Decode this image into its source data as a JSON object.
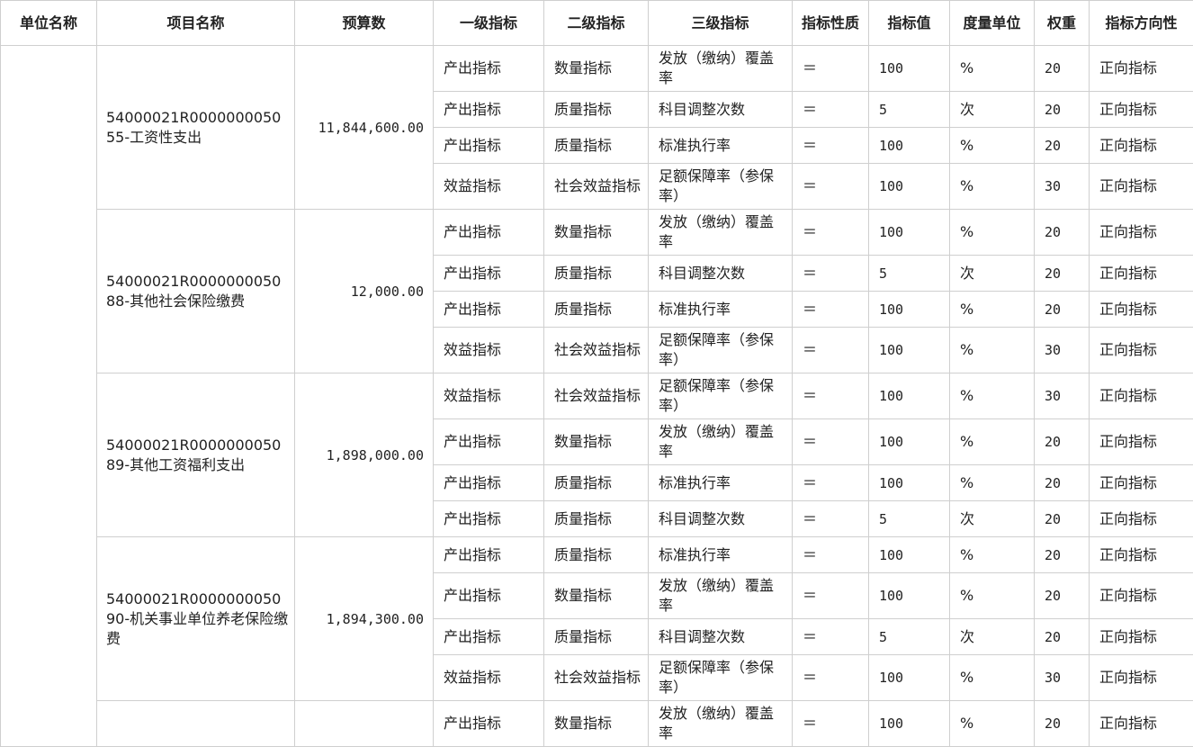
{
  "headers": [
    "单位名称",
    "项目名称",
    "预算数",
    "一级指标",
    "二级指标",
    "三级指标",
    "指标性质",
    "指标值",
    "度量单位",
    "权重",
    "指标方向性"
  ],
  "unit_name": "",
  "projects": [
    {
      "name": "54000021R000000005055-工资性支出",
      "budget": "11,844,600.00",
      "rows": [
        {
          "l1": "产出指标",
          "l2": "数量指标",
          "l3": "发放（缴纳）覆盖率",
          "nature": "＝",
          "value": "100",
          "unit": "%",
          "weight": "20",
          "direction": "正向指标"
        },
        {
          "l1": "产出指标",
          "l2": "质量指标",
          "l3": "科目调整次数",
          "nature": "＝",
          "value": "5",
          "unit": "次",
          "weight": "20",
          "direction": "正向指标"
        },
        {
          "l1": "产出指标",
          "l2": "质量指标",
          "l3": "标准执行率",
          "nature": "＝",
          "value": "100",
          "unit": "%",
          "weight": "20",
          "direction": "正向指标"
        },
        {
          "l1": "效益指标",
          "l2": "社会效益指标",
          "l3": "足额保障率（参保率）",
          "nature": "＝",
          "value": "100",
          "unit": "%",
          "weight": "30",
          "direction": "正向指标"
        }
      ]
    },
    {
      "name": "54000021R000000005088-其他社会保险缴费",
      "budget": "12,000.00",
      "rows": [
        {
          "l1": "产出指标",
          "l2": "数量指标",
          "l3": "发放（缴纳）覆盖率",
          "nature": "＝",
          "value": "100",
          "unit": "%",
          "weight": "20",
          "direction": "正向指标"
        },
        {
          "l1": "产出指标",
          "l2": "质量指标",
          "l3": "科目调整次数",
          "nature": "＝",
          "value": "5",
          "unit": "次",
          "weight": "20",
          "direction": "正向指标"
        },
        {
          "l1": "产出指标",
          "l2": "质量指标",
          "l3": "标准执行率",
          "nature": "＝",
          "value": "100",
          "unit": "%",
          "weight": "20",
          "direction": "正向指标"
        },
        {
          "l1": "效益指标",
          "l2": "社会效益指标",
          "l3": "足额保障率（参保率）",
          "nature": "＝",
          "value": "100",
          "unit": "%",
          "weight": "30",
          "direction": "正向指标"
        }
      ]
    },
    {
      "name": "54000021R000000005089-其他工资福利支出",
      "budget": "1,898,000.00",
      "rows": [
        {
          "l1": "效益指标",
          "l2": "社会效益指标",
          "l3": "足额保障率（参保率）",
          "nature": "＝",
          "value": "100",
          "unit": "%",
          "weight": "30",
          "direction": "正向指标"
        },
        {
          "l1": "产出指标",
          "l2": "数量指标",
          "l3": "发放（缴纳）覆盖率",
          "nature": "＝",
          "value": "100",
          "unit": "%",
          "weight": "20",
          "direction": "正向指标"
        },
        {
          "l1": "产出指标",
          "l2": "质量指标",
          "l3": "标准执行率",
          "nature": "＝",
          "value": "100",
          "unit": "%",
          "weight": "20",
          "direction": "正向指标"
        },
        {
          "l1": "产出指标",
          "l2": "质量指标",
          "l3": "科目调整次数",
          "nature": "＝",
          "value": "5",
          "unit": "次",
          "weight": "20",
          "direction": "正向指标"
        }
      ]
    },
    {
      "name": "54000021R000000005090-机关事业单位养老保险缴费",
      "budget": "1,894,300.00",
      "rows": [
        {
          "l1": "产出指标",
          "l2": "质量指标",
          "l3": "标准执行率",
          "nature": "＝",
          "value": "100",
          "unit": "%",
          "weight": "20",
          "direction": "正向指标"
        },
        {
          "l1": "产出指标",
          "l2": "数量指标",
          "l3": "发放（缴纳）覆盖率",
          "nature": "＝",
          "value": "100",
          "unit": "%",
          "weight": "20",
          "direction": "正向指标"
        },
        {
          "l1": "产出指标",
          "l2": "质量指标",
          "l3": "科目调整次数",
          "nature": "＝",
          "value": "5",
          "unit": "次",
          "weight": "20",
          "direction": "正向指标"
        },
        {
          "l1": "效益指标",
          "l2": "社会效益指标",
          "l3": "足额保障率（参保率）",
          "nature": "＝",
          "value": "100",
          "unit": "%",
          "weight": "30",
          "direction": "正向指标"
        }
      ]
    },
    {
      "name": "",
      "budget": "",
      "rows": [
        {
          "l1": "产出指标",
          "l2": "数量指标",
          "l3": "发放（缴纳）覆盖率",
          "nature": "＝",
          "value": "100",
          "unit": "%",
          "weight": "20",
          "direction": "正向指标"
        }
      ]
    }
  ]
}
